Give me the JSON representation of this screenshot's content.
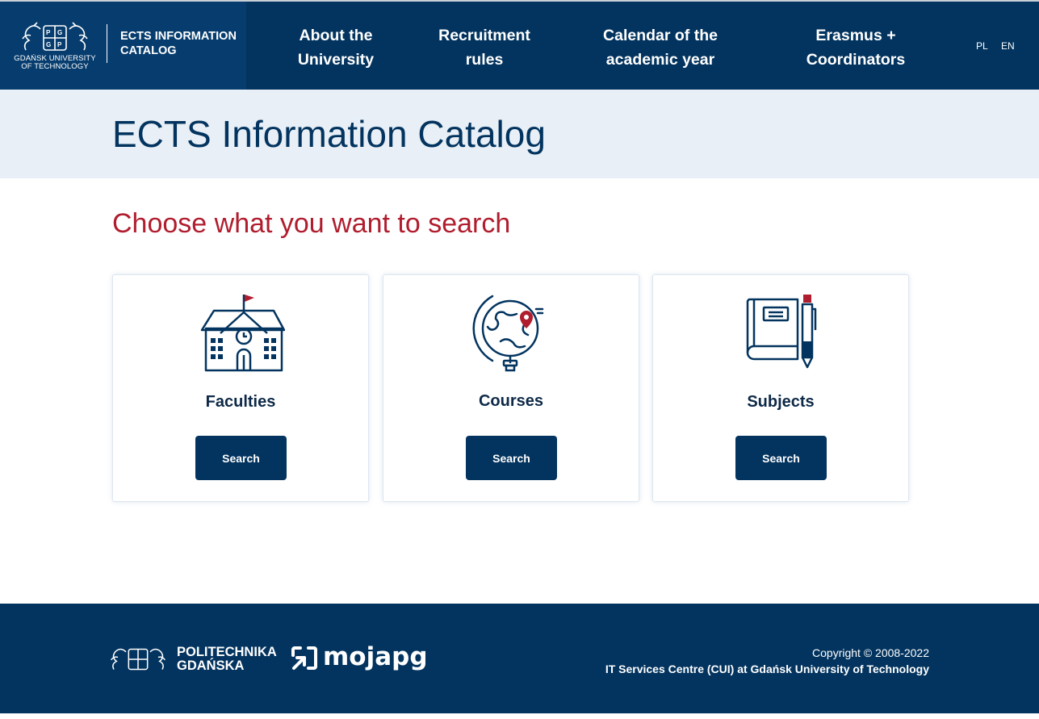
{
  "header": {
    "university_name": "GDAŃSK UNIVERSITY OF TECHNOLOGY",
    "catalog_title": "ECTS INFORMATION\nCATALOG",
    "nav": [
      {
        "label": "About the\nUniversity"
      },
      {
        "label": "Recruitment\nrules"
      },
      {
        "label": "Calendar of the\nacademic year"
      },
      {
        "label": "Erasmus +\nCoordinators"
      }
    ],
    "languages": [
      "PL",
      "EN"
    ]
  },
  "hero": {
    "title": "ECTS Information Catalog"
  },
  "main": {
    "subtitle": "Choose what you want to search",
    "cards": [
      {
        "label": "Faculties",
        "button": "Search",
        "icon": "faculty-building-icon"
      },
      {
        "label": "Courses",
        "button": "Search",
        "icon": "globe-icon"
      },
      {
        "label": "Subjects",
        "button": "Search",
        "icon": "notebook-pen-icon"
      }
    ]
  },
  "footer": {
    "pg_name": "POLITECHNIKA\nGDAŃSKA",
    "mojapg": "mojapg",
    "copyright": "Copyright © 2008-2022",
    "cui": "IT Services Centre (CUI) at Gdańsk University of Technology"
  },
  "colors": {
    "navy": "#03345f",
    "brand_bg": "#073d6e",
    "hero_bg": "#e8eff6",
    "accent_red": "#b01d2e"
  }
}
